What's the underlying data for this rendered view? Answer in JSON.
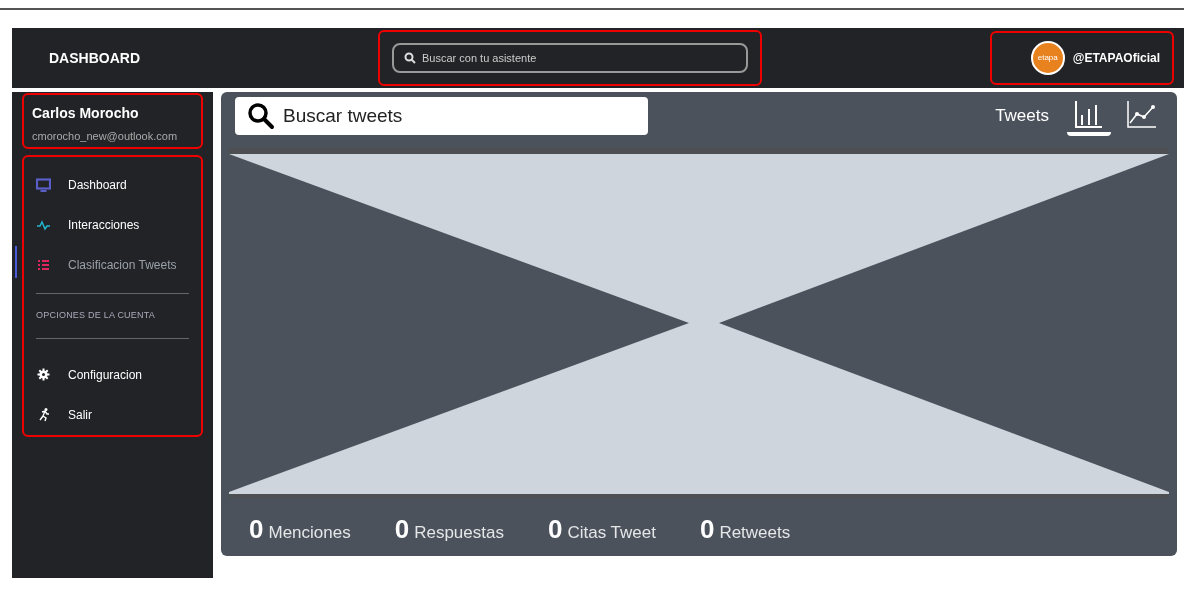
{
  "header": {
    "title": "DASHBOARD",
    "search": {
      "placeholder": "Buscar con tu asistente"
    },
    "account": {
      "avatar_text": "etapa",
      "handle": "@ETAPAOficial"
    }
  },
  "user": {
    "name": "Carlos Morocho",
    "email": "cmorocho_new@outlook.com"
  },
  "sidebar": {
    "items": [
      {
        "label": "Dashboard",
        "kind": "monitor",
        "color": "#5a5fc8",
        "selected": false
      },
      {
        "label": "Interacciones",
        "kind": "pulse",
        "color": "#22b8cf",
        "selected": false
      },
      {
        "label": "Clasificacion Tweets",
        "kind": "list",
        "color": "#e0245e",
        "selected": true
      }
    ],
    "section_title": "OPCIONES DE LA CUENTA",
    "account_items": [
      {
        "label": "Configuracion",
        "kind": "gear"
      },
      {
        "label": "Salir",
        "kind": "runner"
      }
    ]
  },
  "panel": {
    "search": {
      "placeholder": "Buscar tweets"
    },
    "view_label": "Tweets",
    "views": [
      {
        "kind": "bar",
        "selected": true
      },
      {
        "kind": "line",
        "selected": false
      }
    ],
    "stats": [
      {
        "value": "0",
        "label": "Menciones"
      },
      {
        "value": "0",
        "label": "Respuestas"
      },
      {
        "value": "0",
        "label": "Citas Tweet"
      },
      {
        "value": "0",
        "label": "Retweets"
      }
    ]
  }
}
